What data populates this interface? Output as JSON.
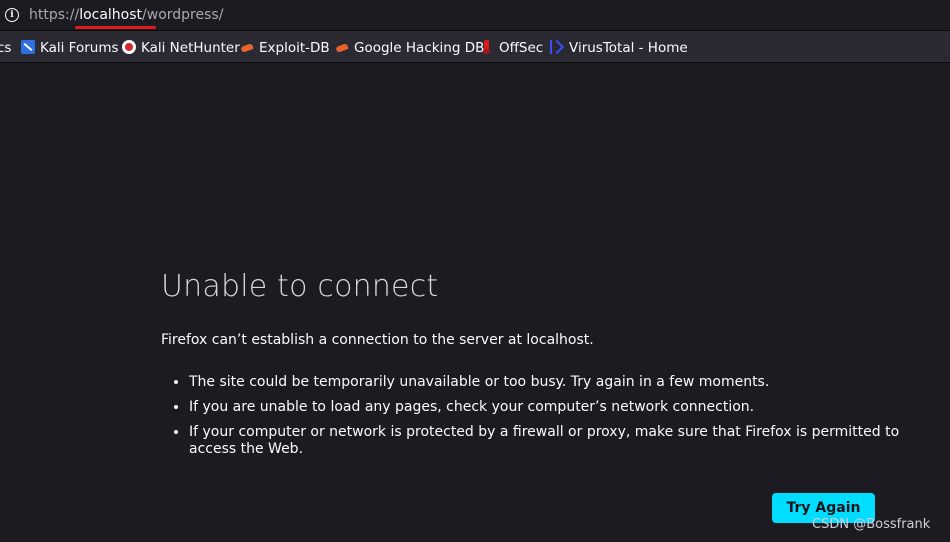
{
  "urlbar": {
    "icon": "info-icon",
    "scheme": "https://",
    "host": "localhost",
    "path": "/wordpress/"
  },
  "bookmarks": [
    {
      "label": "cs",
      "icon": ""
    },
    {
      "label": "Kali Forums",
      "icon": "kali-icon"
    },
    {
      "label": "Kali NetHunter",
      "icon": "nethunter-icon"
    },
    {
      "label": "Exploit-DB",
      "icon": "exploit-db-icon"
    },
    {
      "label": "Google Hacking DB",
      "icon": "exploit-db-icon"
    },
    {
      "label": "OffSec",
      "icon": "offsec-icon"
    },
    {
      "label": "VirusTotal - Home",
      "icon": "virustotal-icon"
    }
  ],
  "error": {
    "title": "Unable to connect",
    "message": "Firefox can’t establish a connection to the server at localhost.",
    "reasons": [
      "The site could be temporarily unavailable or too busy. Try again in a few moments.",
      "If you are unable to load any pages, check your computer’s network connection.",
      "If your computer or network is protected by a firewall or proxy, make sure that Firefox is permitted to access the Web."
    ],
    "button_label": "Try Again"
  },
  "watermark": "CSDN @Bossfrank",
  "colors": {
    "background": "#1c1b22",
    "toolbar": "#2b2a33",
    "accent_button": "#00ddff",
    "underline": "#e0191e"
  }
}
